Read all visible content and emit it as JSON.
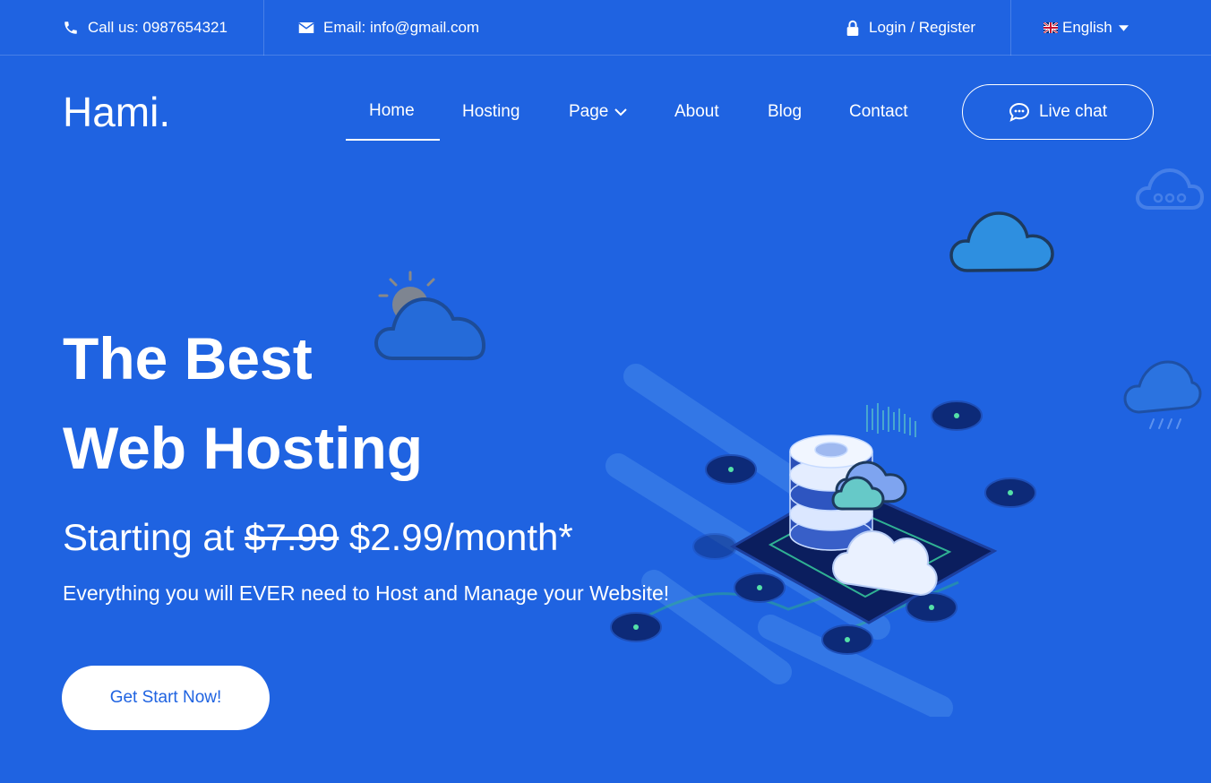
{
  "topbar": {
    "call": "Call us: 0987654321",
    "email": "Email: info@gmail.com",
    "login": "Login / Register",
    "language": "English"
  },
  "nav": {
    "logo": "Hami.",
    "items": [
      "Home",
      "Hosting",
      "Page",
      "About",
      "Blog",
      "Contact"
    ],
    "active": "Home",
    "live_chat": "Live chat"
  },
  "hero": {
    "title_line1": "The Best",
    "title_line2": "Web Hosting",
    "price_prefix": "Starting at",
    "price_old": "$7.99",
    "price_new": "$2.99/month*",
    "subtitle": "Everything you will EVER need to Host and Manage your Website!",
    "cta": "Get Start Now!"
  },
  "icons": [
    "phone-icon",
    "envelope-icon",
    "lock-icon",
    "uk-flag-icon",
    "caret-down-icon",
    "chevron-down-icon",
    "chat-icon"
  ],
  "colors": {
    "background": "#1f63e1",
    "text": "#ffffff",
    "button_text": "#1f63e1"
  }
}
